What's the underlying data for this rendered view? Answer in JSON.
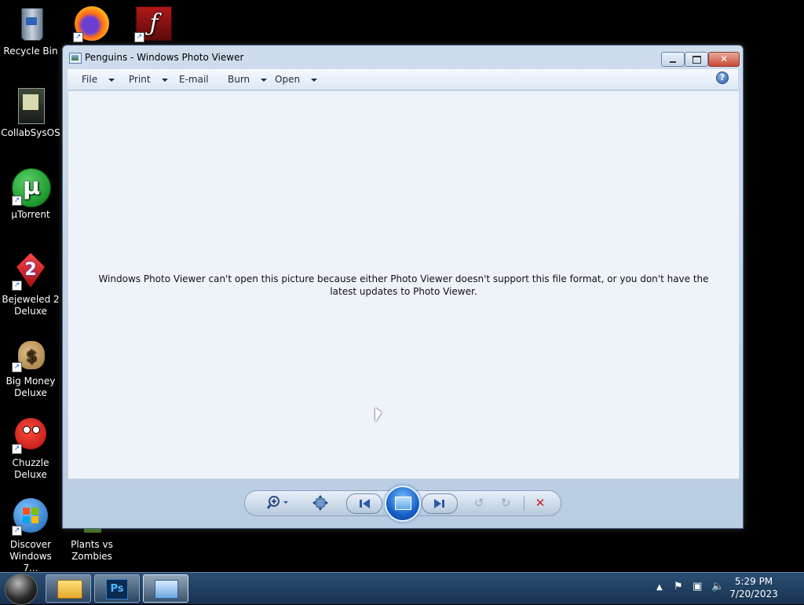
{
  "desktop": {
    "icons": [
      {
        "label": "Recycle Bin"
      },
      {
        "label": ""
      },
      {
        "label": ""
      },
      {
        "label": "CollabSysOS"
      },
      {
        "label": "µTorrent"
      },
      {
        "label": "Bejeweled 2 Deluxe"
      },
      {
        "label": "Big Money Deluxe"
      },
      {
        "label": "Chuzzle Deluxe"
      },
      {
        "label": "Discover Windows 7..."
      },
      {
        "label": "Plants vs Zombies"
      }
    ]
  },
  "window": {
    "title": "Penguins - Windows Photo Viewer",
    "menu": {
      "file": "File",
      "print": "Print",
      "email": "E-mail",
      "burn": "Burn",
      "open": "Open"
    },
    "help": "?",
    "message": "Windows Photo Viewer can't open this picture because either Photo Viewer doesn't support this file format, or you don't have the latest updates to Photo Viewer."
  },
  "controls": [
    "zoom-icon",
    "fit-icon",
    "previous-icon",
    "slideshow-icon",
    "next-icon",
    "rotate-left-icon",
    "rotate-right-icon",
    "delete-icon"
  ],
  "taskbar": {
    "items": [
      "explorer-icon",
      "photoshop-icon",
      "photo-viewer-icon"
    ],
    "ps_label": "Ps",
    "time": "5:29 PM",
    "date": "7/20/2023"
  },
  "colors": {
    "accent": "#2a5ca8",
    "delete": "#cc1f1f",
    "taskbar": "#1f4063"
  }
}
